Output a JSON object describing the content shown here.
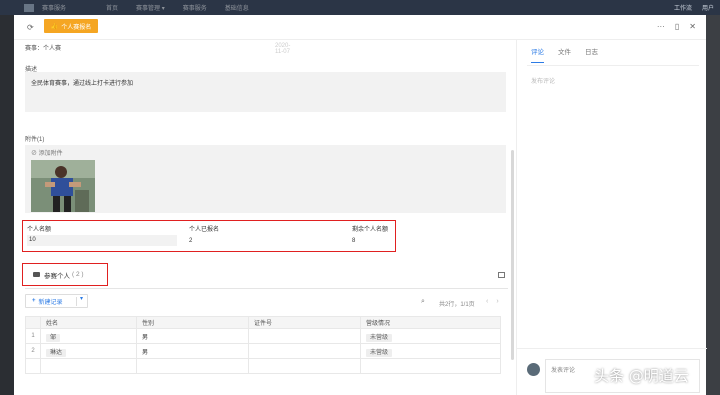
{
  "background": {
    "nav_items": [
      "首页",
      "赛事管理 ▾",
      "赛事服务",
      "基础信息"
    ],
    "app_name": "赛事服务",
    "right_items": [
      "工作流",
      "用户"
    ]
  },
  "header": {
    "action_button": "个人赛报名",
    "colors": {
      "accent": "#f5a623",
      "primary": "#2c7be5",
      "highlight": "#e02020"
    }
  },
  "form": {
    "event_row": "赛事：个人赛",
    "date_placeholder": "2020-11-07",
    "description_label": "描述",
    "description_text": "全民体育赛事，通过线上打卡进行参加",
    "attachment_label": "附件(1)",
    "add_attachment": "添加附件",
    "quota": {
      "col1_label": "个人名额",
      "col1_value": "10",
      "col2_label": "个人已报名",
      "col2_value": "2",
      "col3_label": "剩余个人名额",
      "col3_value": "8"
    },
    "participant_section": "参赛个人",
    "participant_count": "( 2 )",
    "add_record": "新建记录",
    "pager_text": "共2行，1/1页",
    "table": {
      "headers": [
        "姓名",
        "性别",
        "证件号",
        "营级情况"
      ],
      "rows": [
        {
          "idx": "1",
          "name": "邹",
          "gender": "男",
          "id": "",
          "status": "未营级"
        },
        {
          "idx": "2",
          "name": "琳达",
          "gender": "男",
          "id": "",
          "status": "未营级"
        }
      ]
    }
  },
  "sidebar": {
    "tabs": [
      "评论",
      "文件",
      "日志"
    ],
    "placeholder": "发布评论",
    "comment_placeholder": "发表评论"
  },
  "watermark": "头条 @明道云"
}
